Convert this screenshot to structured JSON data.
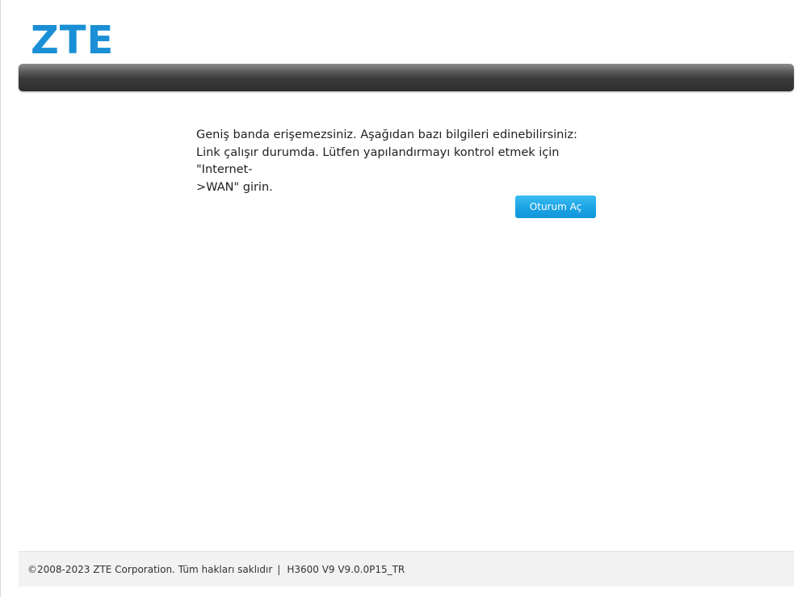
{
  "header": {
    "logo_text": "ZTE",
    "brand_color": "#1a8fd6"
  },
  "message": {
    "line1": "Geniş banda erişemezsiniz. Aşağıdan bazı bilgileri edinebilirsiniz:",
    "line2": "Link çalışır durumda. Lütfen yapılandırmayı kontrol etmek için \"Internet-",
    "line3": ">WAN\" girin."
  },
  "actions": {
    "login_label": "Oturum Aç",
    "button_color": "#1aa3e4"
  },
  "footer": {
    "copyright": "©2008-2023 ZTE Corporation. Tüm hakları saklıdır",
    "separator": "|",
    "version": "H3600 V9 V9.0.0P15_TR"
  }
}
